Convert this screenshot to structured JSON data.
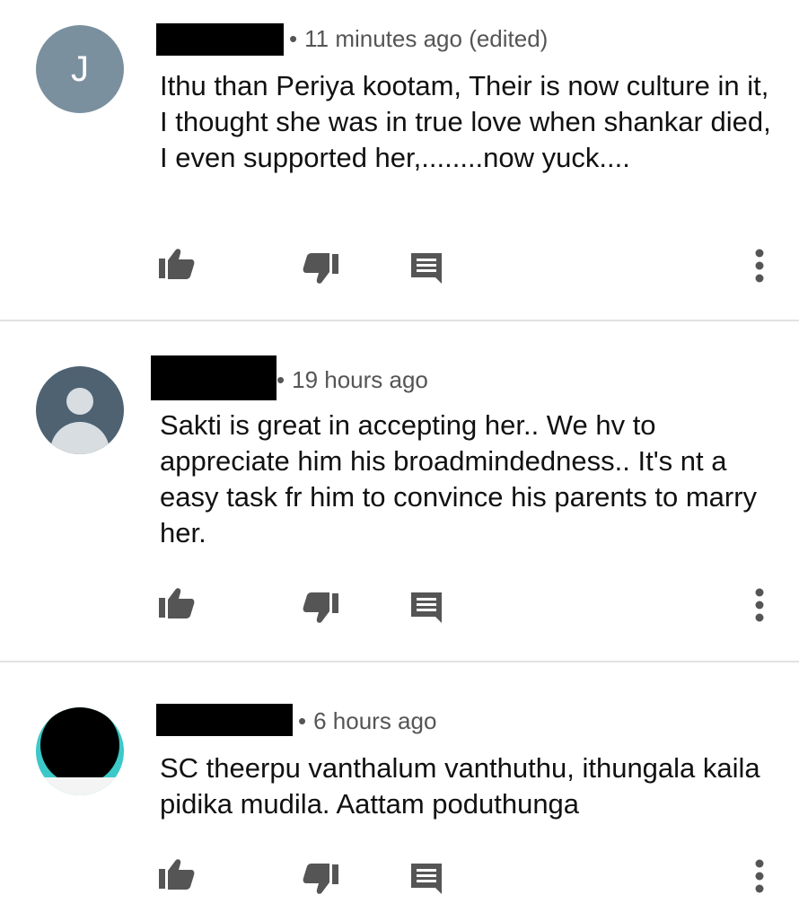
{
  "comments": [
    {
      "avatar_letter": "J",
      "avatar_type": "letter",
      "timestamp": "11 minutes ago (edited)",
      "separator": "•",
      "text": "Ithu than Periya kootam, Their is now culture in it, I thought she was in true love when shankar died, I even supported her,........now yuck...."
    },
    {
      "avatar_type": "default-person",
      "timestamp": "19 hours ago",
      "separator": "•",
      "text": "Sakti  is great in accepting her.. We hv to appreciate him his broadmindedness.. It's nt a easy task fr him to convince his parents to marry her."
    },
    {
      "avatar_type": "photo",
      "timestamp": "6 hours ago",
      "separator": "•",
      "text": "SC theerpu vanthalum vanthuthu, ithungala kaila pidika mudila. Aattam poduthunga"
    }
  ],
  "icons": {
    "like": "thumbs-up-icon",
    "dislike": "thumbs-down-icon",
    "reply": "reply-icon",
    "more": "more-vert-icon"
  },
  "colors": {
    "icon": "#555555",
    "meta": "#555555",
    "text": "#111111",
    "divider": "#e2e2e2",
    "avatar_letter_bg": "#7b909f",
    "avatar_person_bg": "#4e6272",
    "avatar_photo_ring": "#3cc8c8"
  }
}
